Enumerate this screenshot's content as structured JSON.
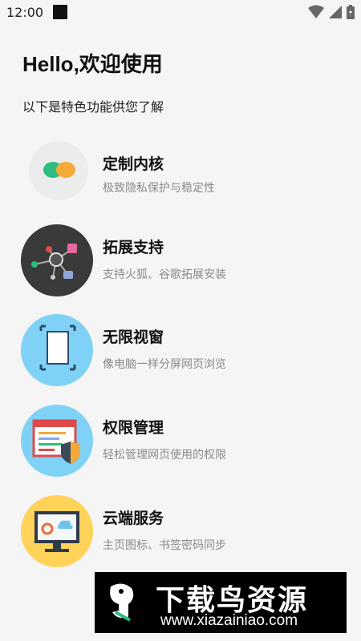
{
  "status_bar": {
    "time": "12:00",
    "icons": [
      "wifi-icon",
      "signal-icon",
      "battery-icon"
    ]
  },
  "header": {
    "title": "Hello,欢迎使用",
    "subtitle": "以下是特色功能供您了解"
  },
  "features": [
    {
      "title": "定制内核",
      "desc": "极致隐私保护与稳定性",
      "icon": "custom-kernel-icon"
    },
    {
      "title": "拓展支持",
      "desc": "支持火狐、谷歌拓展安装",
      "icon": "extension-icon"
    },
    {
      "title": "无限视窗",
      "desc": "像电脑一样分屏网页浏览",
      "icon": "window-icon"
    },
    {
      "title": "权限管理",
      "desc": "轻松管理网页使用的权限",
      "icon": "permission-icon"
    },
    {
      "title": "云端服务",
      "desc": "主页图标、书签密码同步",
      "icon": "cloud-service-icon"
    }
  ],
  "watermark": {
    "title": "下载鸟资源",
    "url": "www.xiazainiao.com"
  },
  "colors": {
    "background": "#f5f5f5",
    "green": "#2dbd7f",
    "orange": "#f5a93a",
    "light_blue": "#7fd2f5",
    "yellow": "#ffd25a",
    "dark": "#333333"
  }
}
